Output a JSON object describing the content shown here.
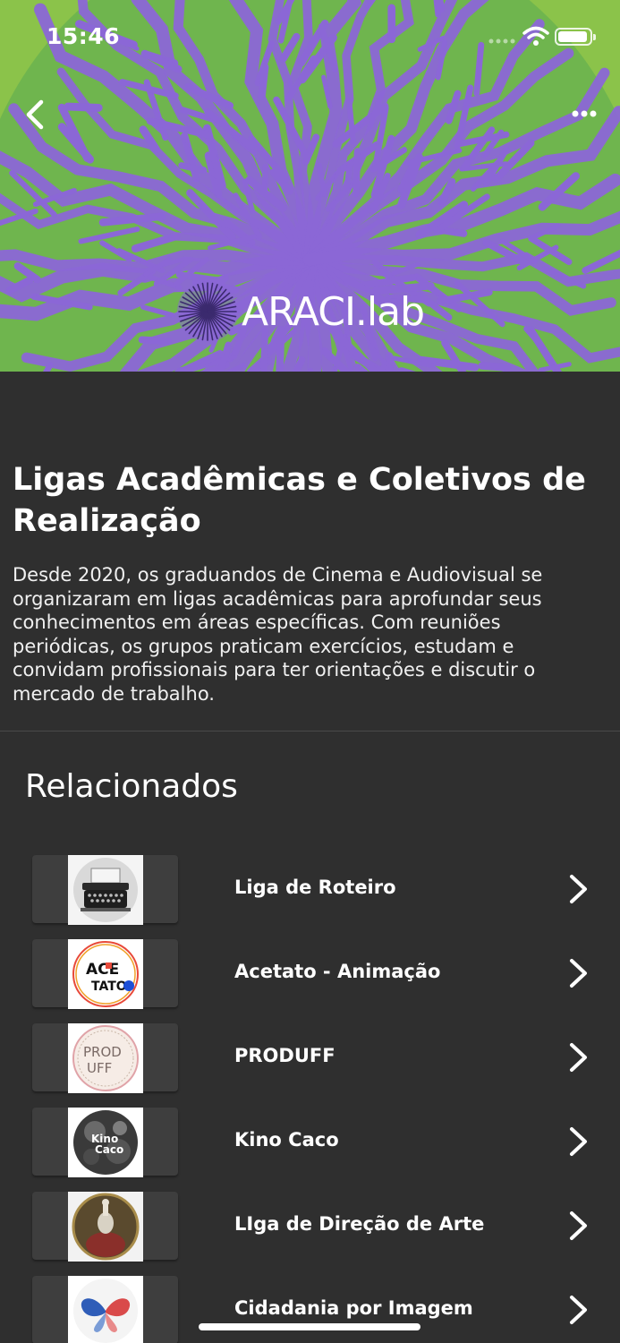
{
  "status": {
    "time": "15:46"
  },
  "hero": {
    "logo_text": "ARACI.lab"
  },
  "article": {
    "title": "Ligas Acadêmicas e Coletivos de Realização",
    "description": "Desde 2020, os graduandos de Cinema e Audiovisual se organizaram em ligas acadêmicas para aprofundar seus conhecimentos em áreas específicas. Com reuniões periódicas, os grupos praticam exercícios, estudam e convidam profissionais para ter orientações e discutir o mercado de trabalho."
  },
  "related": {
    "title": "Relacionados",
    "items": [
      {
        "label": "Liga de Roteiro",
        "thumb": "typewriter"
      },
      {
        "label": "Acetato - Animação",
        "thumb": "acetato-logo",
        "thumb_text_1": "ACE",
        "thumb_text_2": "TATO"
      },
      {
        "label": "PRODUFF",
        "thumb": "produff-logo",
        "thumb_text_1": "PROD",
        "thumb_text_2": "UFF"
      },
      {
        "label": "Kino Caco",
        "thumb": "kino-caco-logo",
        "thumb_text_1": "Kino",
        "thumb_text_2": "Caco"
      },
      {
        "label": "LIga de Direção de Arte",
        "thumb": "art-portrait"
      },
      {
        "label": "Cidadania por Imagem",
        "thumb": "butterfly"
      }
    ]
  },
  "colors": {
    "background": "#2f2f2f",
    "hero_green": "#7cc04a",
    "hero_purple": "#8b67d6"
  }
}
